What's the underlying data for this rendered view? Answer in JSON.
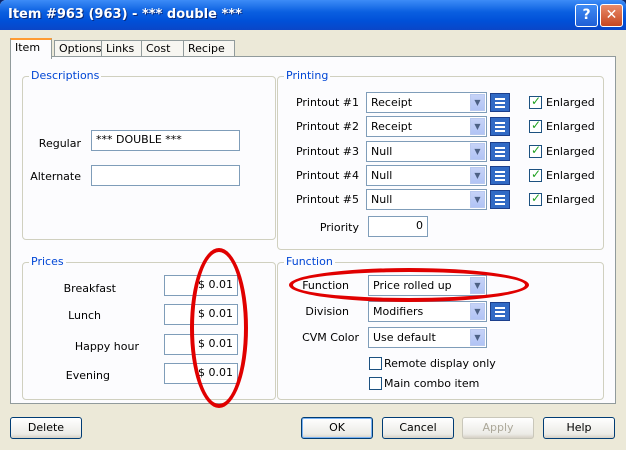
{
  "window": {
    "title": "Item #963 (963) - *** double ***",
    "help_glyph": "?",
    "close_glyph": "✕"
  },
  "tabs": [
    {
      "label": "Item",
      "active": true
    },
    {
      "label": "Options",
      "active": false
    },
    {
      "label": "Links",
      "active": false
    },
    {
      "label": "Cost",
      "active": false
    },
    {
      "label": "Recipe",
      "active": false
    }
  ],
  "descriptions": {
    "title": "Descriptions",
    "regular_label": "Regular",
    "regular_value": "*** DOUBLE ***",
    "alternate_label": "Alternate",
    "alternate_value": ""
  },
  "printing": {
    "title": "Printing",
    "printouts": [
      {
        "label": "Printout #1",
        "value": "Receipt",
        "enlarged_label": "Enlarged",
        "enlarged": true
      },
      {
        "label": "Printout #2",
        "value": "Receipt",
        "enlarged_label": "Enlarged",
        "enlarged": true
      },
      {
        "label": "Printout #3",
        "value": "Null",
        "enlarged_label": "Enlarged",
        "enlarged": true
      },
      {
        "label": "Printout #4",
        "value": "Null",
        "enlarged_label": "Enlarged",
        "enlarged": true
      },
      {
        "label": "Printout #5",
        "value": "Null",
        "enlarged_label": "Enlarged",
        "enlarged": true
      }
    ],
    "priority_label": "Priority",
    "priority_value": "0"
  },
  "prices": {
    "title": "Prices",
    "rows": [
      {
        "label": "Breakfast",
        "value": "$ 0.01"
      },
      {
        "label": "Lunch",
        "value": "$ 0.01"
      },
      {
        "label": "Happy hour",
        "value": "$ 0.01"
      },
      {
        "label": "Evening",
        "value": "$ 0.01"
      }
    ]
  },
  "function": {
    "title": "Function",
    "function_label": "Function",
    "function_value": "Price rolled up",
    "division_label": "Division",
    "division_value": "Modifiers",
    "cvm_label": "CVM Color",
    "cvm_value": "Use default",
    "remote_display_label": "Remote display only",
    "remote_display": false,
    "main_combo_label": "Main combo item",
    "main_combo": false
  },
  "buttons": {
    "delete": "Delete",
    "ok": "OK",
    "cancel": "Cancel",
    "apply": "Apply",
    "help": "Help"
  },
  "icons": {
    "dropdown_arrow": "▼",
    "check": "✓"
  },
  "colors": {
    "annotation": "#e00000",
    "group_title": "#0046d5",
    "titlebar": "#0050d8"
  }
}
